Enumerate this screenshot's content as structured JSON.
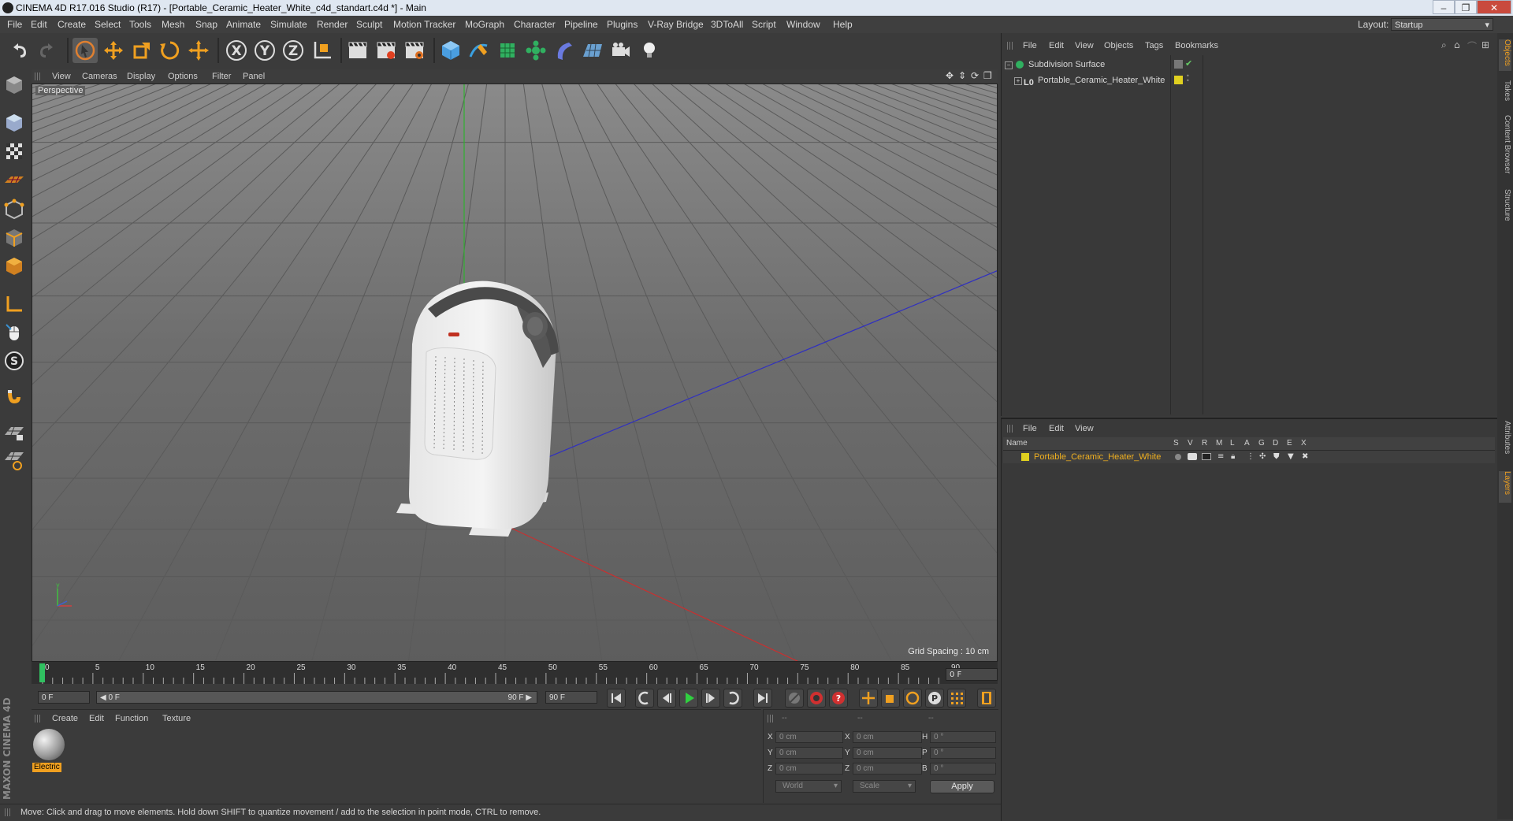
{
  "window": {
    "title": "CINEMA 4D R17.016 Studio (R17) - [Portable_Ceramic_Heater_White_c4d_standart.c4d *] - Main",
    "minimize": "–",
    "maximize": "❐",
    "close": "✕"
  },
  "menubar": {
    "items": [
      "File",
      "Edit",
      "Create",
      "Select",
      "Tools",
      "Mesh",
      "Snap",
      "Animate",
      "Simulate",
      "Render",
      "Sculpt",
      "Motion Tracker",
      "MoGraph",
      "Character",
      "Pipeline",
      "Plugins",
      "V-Ray Bridge",
      "3DToAll",
      "Script",
      "Window",
      "Help"
    ],
    "layout_label": "Layout:",
    "layout_value": "Startup"
  },
  "viewport": {
    "menu": [
      "View",
      "Cameras",
      "Display",
      "Options",
      "Filter",
      "Panel"
    ],
    "label": "Perspective",
    "grid_spacing": "Grid Spacing : 10 cm",
    "axis_x_color": "#c83030",
    "axis_y_color": "#30b030",
    "axis_z_color": "#3030c0"
  },
  "timeline": {
    "ticks": [
      "0",
      "5",
      "10",
      "15",
      "20",
      "25",
      "30",
      "35",
      "40",
      "45",
      "50",
      "55",
      "60",
      "65",
      "70",
      "75",
      "80",
      "85",
      "90"
    ],
    "current_frame": "0 F",
    "end_box": "0 F"
  },
  "transport": {
    "start_field": "0 F",
    "range_start": "◀ 0 F",
    "range_end": "90 F ▶",
    "end_field": "90 F"
  },
  "material_manager": {
    "menu": [
      "Create",
      "Edit",
      "Function",
      "Texture"
    ],
    "material_name": "Electric"
  },
  "coordinates": {
    "header": [
      "--",
      "--",
      "--"
    ],
    "rows": [
      {
        "l1": "X",
        "v1": "0 cm",
        "l2": "X",
        "v2": "0 cm",
        "l3": "H",
        "v3": "0 °"
      },
      {
        "l1": "Y",
        "v1": "0 cm",
        "l2": "Y",
        "v2": "0 cm",
        "l3": "P",
        "v3": "0 °"
      },
      {
        "l1": "Z",
        "v1": "0 cm",
        "l2": "Z",
        "v2": "0 cm",
        "l3": "B",
        "v3": "0 °"
      }
    ],
    "mode_world": "World",
    "mode_scale": "Scale",
    "apply": "Apply"
  },
  "status": {
    "text": "Move: Click and drag to move elements. Hold down SHIFT to quantize movement / add to the selection in point mode, CTRL to remove."
  },
  "object_manager": {
    "menu": [
      "File",
      "Edit",
      "View",
      "Objects",
      "Tags",
      "Bookmarks"
    ],
    "objects": [
      {
        "name": "Subdivision Surface"
      },
      {
        "name": "Portable_Ceramic_Heater_White"
      }
    ],
    "layer_color": "#e0d020"
  },
  "layer_manager": {
    "menu": [
      "File",
      "Edit",
      "View"
    ],
    "columns": [
      "Name",
      "S",
      "V",
      "R",
      "M",
      "L",
      "A",
      "G",
      "D",
      "E",
      "X"
    ],
    "layer_name": "Portable_Ceramic_Heater_White"
  },
  "side_tabs": [
    "Objects",
    "Takes",
    "Content Browser",
    "Structure",
    "Attributes",
    "Layers"
  ],
  "brand": {
    "logo_text": "MAXON CINEMA 4D"
  }
}
